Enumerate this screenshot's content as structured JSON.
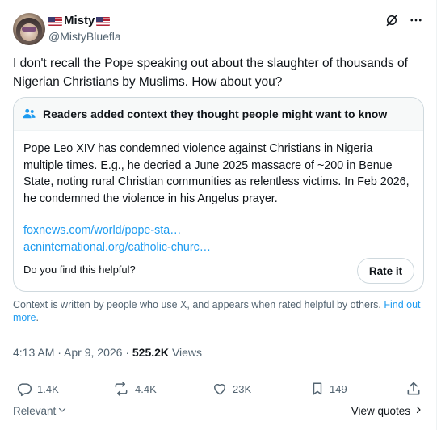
{
  "author": {
    "display_name": "Misty",
    "handle": "@MistyBluefla"
  },
  "tweet": {
    "text": "I don't recall the Pope speaking out about the slaughter of thousands of Nigerian Christians by Muslims. How about you?"
  },
  "note": {
    "header": "Readers added context they thought people might want to know",
    "body": "Pope Leo XIV has condemned violence against Christians in Nigeria multiple times. E.g., he decried a June 2025 massacre of ~200 in Benue State, noting rural Christian communities as relentless victims. In Feb 2026, he condemned the violence in his Angelus prayer.",
    "links": [
      "foxnews.com/world/pope-sta…",
      "acninternational.org/catholic-churc…"
    ],
    "helpful_prompt": "Do you find this helpful?",
    "rate_label": "Rate it"
  },
  "context": {
    "text": "Context is written by people who use X, and appears when rated helpful by others.",
    "link": "Find out more"
  },
  "meta": {
    "time": "4:13 AM",
    "date": "Apr 9, 2026",
    "views_count": "525.2K",
    "views_label": "Views"
  },
  "actions": {
    "replies": "1.4K",
    "reposts": "4.4K",
    "likes": "23K",
    "bookmarks": "149"
  },
  "footer": {
    "sort_label": "Relevant",
    "view_quotes": "View quotes"
  },
  "colors": {
    "text": "#0f1419",
    "secondary": "#536471",
    "link": "#1d9bf0",
    "border": "#cfd9de",
    "note_icon": "#1d9bf0"
  },
  "icons": [
    "grok-icon",
    "more-icon",
    "people-icon",
    "reply-icon",
    "repost-icon",
    "like-icon",
    "bookmark-icon",
    "share-icon",
    "chevron-down-icon",
    "chevron-right-icon"
  ]
}
